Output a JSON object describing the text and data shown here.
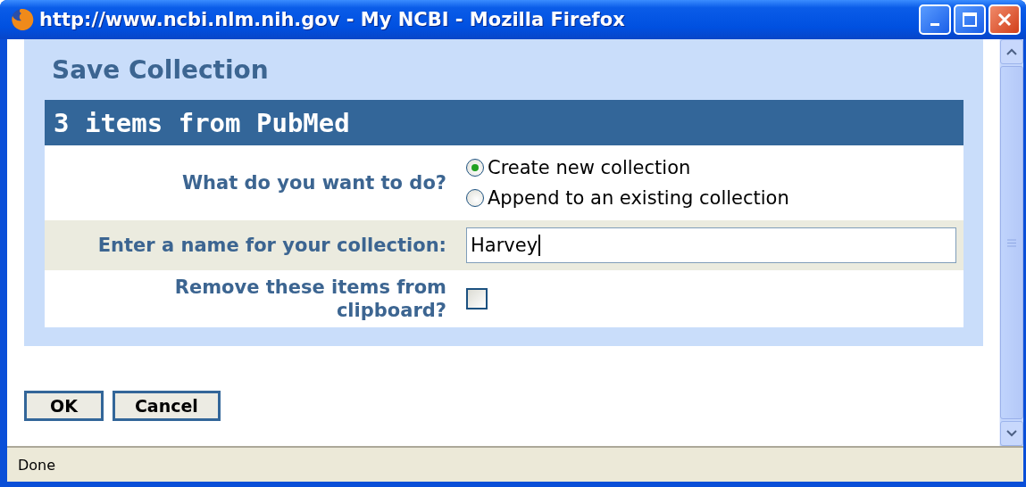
{
  "window": {
    "title": "http://www.ncbi.nlm.nih.gov - My NCBI - Mozilla Firefox"
  },
  "dialog": {
    "title": "Save Collection",
    "header": "3 items from PubMed",
    "rows": [
      {
        "kind": "radio",
        "label": "What do you want to do?",
        "options": [
          {
            "label": "Create new collection",
            "selected": true
          },
          {
            "label": "Append to an existing collection",
            "selected": false
          }
        ]
      },
      {
        "kind": "text",
        "label": "Enter a name for your collection:",
        "value": "Harvey"
      },
      {
        "kind": "checkbox",
        "label": "Remove these items from clipboard?",
        "checked": false
      }
    ]
  },
  "buttons": [
    "OK",
    "Cancel"
  ],
  "status_bar": "Done"
}
